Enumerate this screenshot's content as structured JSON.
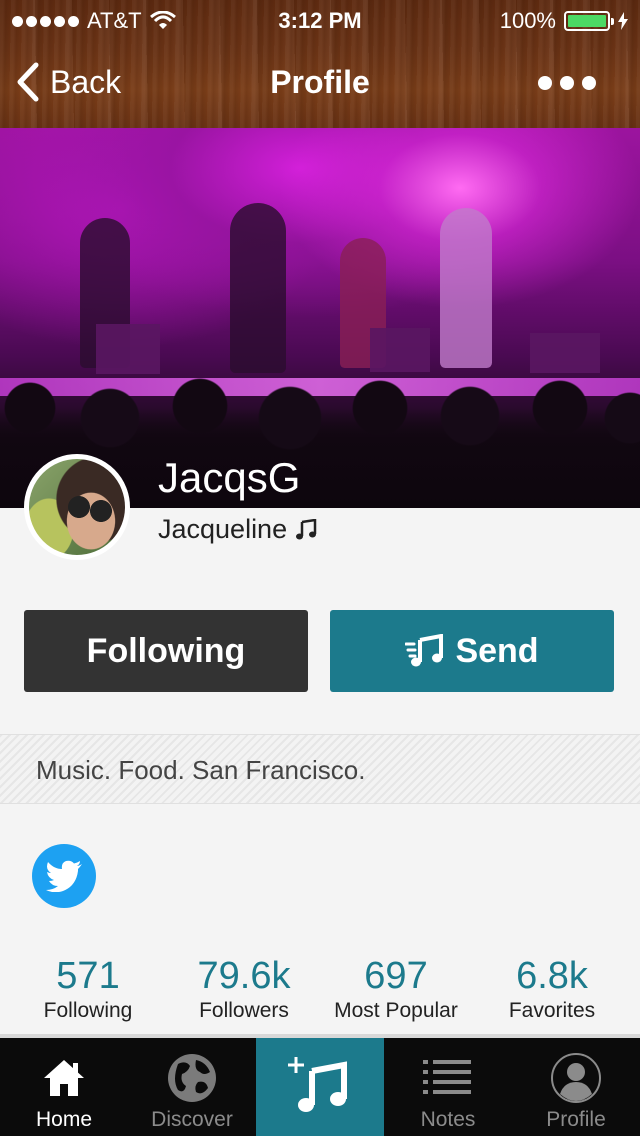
{
  "status_bar": {
    "carrier": "AT&T",
    "time": "3:12 PM",
    "battery": "100%"
  },
  "nav": {
    "back_label": "Back",
    "title": "Profile"
  },
  "profile": {
    "username": "JacqsG",
    "real_name": "Jacqueline",
    "bio": "Music. Food. San Francisco."
  },
  "actions": {
    "following_label": "Following",
    "send_label": "Send"
  },
  "stats": [
    {
      "value": "571",
      "label": "Following"
    },
    {
      "value": "79.6k",
      "label": "Followers"
    },
    {
      "value": "697",
      "label": "Most Popular"
    },
    {
      "value": "6.8k",
      "label": "Favorites"
    }
  ],
  "tabbar": {
    "home": "Home",
    "discover": "Discover",
    "notes": "Notes",
    "profile": "Profile"
  },
  "colors": {
    "accent": "#1c7a8c",
    "twitter": "#1da1f2",
    "dark_button": "#333333"
  }
}
